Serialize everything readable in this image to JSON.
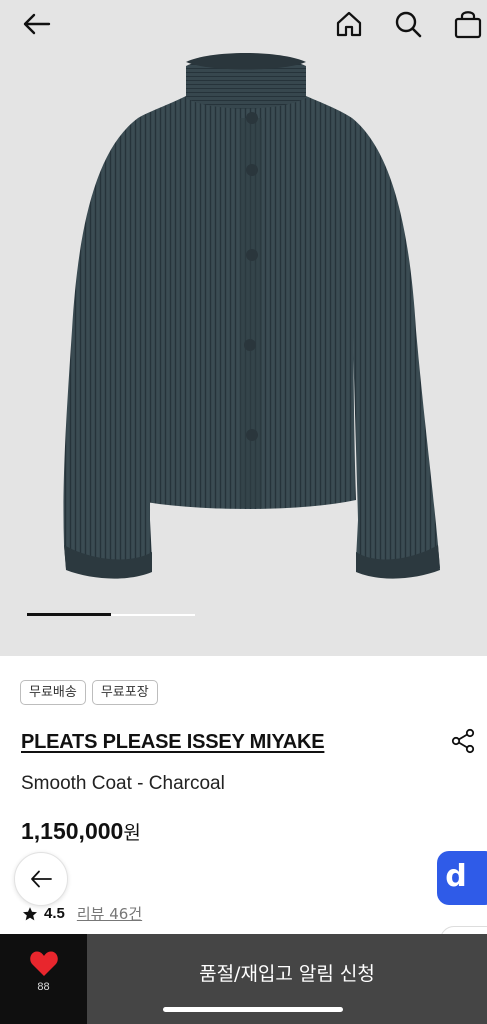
{
  "header": {
    "back_icon": "arrow-left-icon",
    "home_icon": "home-icon",
    "search_icon": "search-icon",
    "bag_icon": "shopping-bag-icon"
  },
  "gallery": {
    "image": "charcoal pleated coat photo",
    "progress": 0.5
  },
  "product": {
    "tags": [
      "무료배송",
      "무료포장"
    ],
    "brand": "PLEATS PLEASE ISSEY MIYAKE",
    "name": "Smooth Coat - Charcoal",
    "price_value": "1,150,000",
    "price_unit": "원",
    "rating": "4.5",
    "review_label": "리뷰 46건"
  },
  "floating": {
    "back_icon": "arrow-left-icon",
    "badge_letter": "d"
  },
  "bottom_bar": {
    "like_count": "88",
    "action_label": "품절/재입고 알림 신청"
  },
  "colors": {
    "coat": "#36464d",
    "hero_bg": "#e4e4e4",
    "badge_blue": "#2f5be8",
    "like_red": "#e8262d",
    "action_bg": "#454545"
  }
}
